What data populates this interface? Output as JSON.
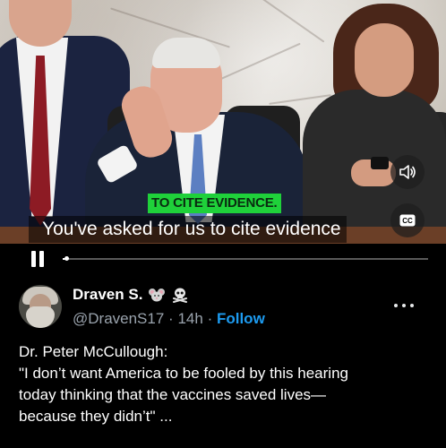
{
  "video": {
    "burned_caption": "TO CITE EVIDENCE.",
    "closed_caption": "You've asked for us to cite evidence",
    "volume_icon": "speaker-icon",
    "cc_label": "CC",
    "progress": 0.01
  },
  "tweet": {
    "display_name": "Draven S.",
    "name_emojis": [
      "mouse-emoji-icon",
      "skull-crossbones-emoji-icon"
    ],
    "handle": "@DravenS17",
    "separator": "·",
    "time": "14h",
    "follow_label": "Follow",
    "text_lines": [
      "Dr. Peter McCullough:",
      "\"I don’t want America to be fooled by this hearing",
      "today thinking that the vaccines saved lives—",
      "because they didn’t\" ..."
    ]
  },
  "colors": {
    "accent": "#1d9bf0",
    "caption_green": "#1fd13a",
    "muted_text": "#9aa3ad",
    "background": "#000000"
  }
}
